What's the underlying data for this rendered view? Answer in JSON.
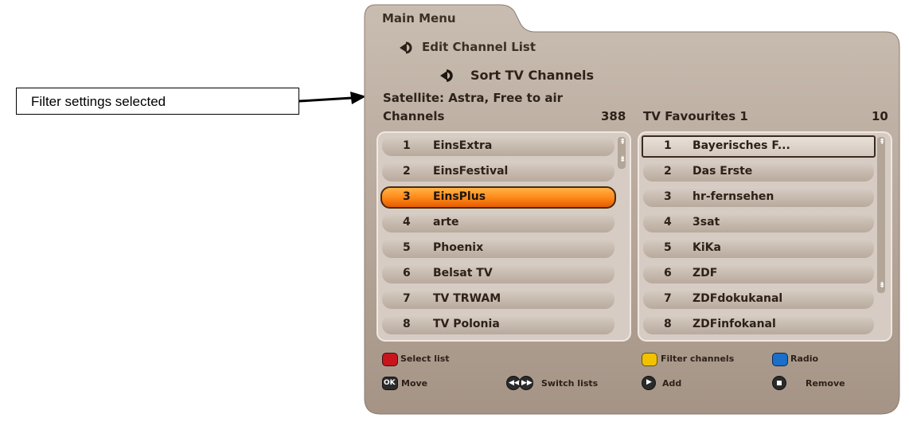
{
  "callout": {
    "label": "Filter settings selected"
  },
  "breadcrumb": {
    "main": "Main Menu",
    "edit": "Edit Channel List",
    "sort": "Sort TV Channels"
  },
  "filter_info": "Satellite: Astra, Free to air",
  "left_list": {
    "title": "Channels",
    "count": "388",
    "selected_index": 2,
    "items": [
      {
        "num": "1",
        "name": "EinsExtra"
      },
      {
        "num": "2",
        "name": "EinsFestival"
      },
      {
        "num": "3",
        "name": "EinsPlus"
      },
      {
        "num": "4",
        "name": "arte"
      },
      {
        "num": "5",
        "name": "Phoenix"
      },
      {
        "num": "6",
        "name": "Belsat TV"
      },
      {
        "num": "7",
        "name": "TV TRWAM"
      },
      {
        "num": "8",
        "name": "TV Polonia"
      }
    ]
  },
  "right_list": {
    "title": "TV Favourites 1",
    "count": "10",
    "items": [
      {
        "num": "1",
        "name": "Bayerisches F..."
      },
      {
        "num": "2",
        "name": "Das Erste"
      },
      {
        "num": "3",
        "name": "hr-fernsehen"
      },
      {
        "num": "4",
        "name": "3sat"
      },
      {
        "num": "5",
        "name": "KiKa"
      },
      {
        "num": "6",
        "name": "ZDF"
      },
      {
        "num": "7",
        "name": "ZDFdokukanal"
      },
      {
        "num": "8",
        "name": "ZDFinfokanal"
      }
    ]
  },
  "legend": {
    "red": "Select list",
    "yellow": "Filter channels",
    "blue": "Radio",
    "ok_symbol": "OK",
    "ok": "Move",
    "switch": "Switch lists",
    "add": "Add",
    "remove": "Remove"
  },
  "colors": {
    "red_key": "#c8141c",
    "yellow_key": "#f2c200",
    "blue_key": "#1a6fc8",
    "highlight": "#ff8a1a"
  }
}
